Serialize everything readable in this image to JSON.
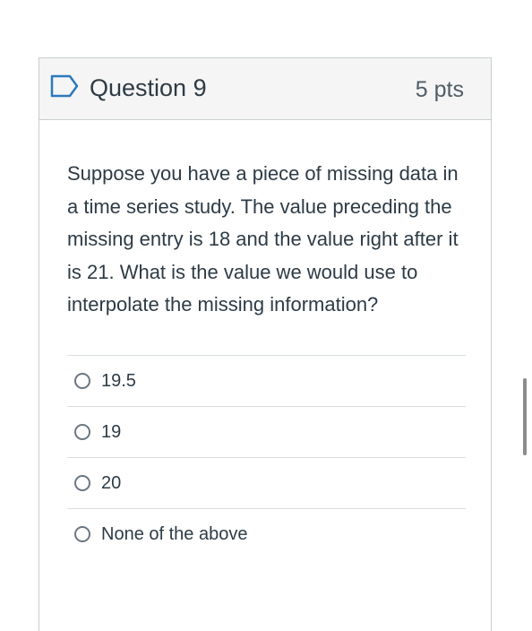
{
  "question": {
    "title": "Question 9",
    "points": "5 pts",
    "flag_icon": "flag-outline-icon",
    "text": "Suppose you have a piece of missing data in a time series study. The value preceding the missing entry is 18 and the value right after it is 21. What is the value we would use to interpolate the missing information?",
    "answers": [
      {
        "label": "19.5",
        "selected": false
      },
      {
        "label": "19",
        "selected": false
      },
      {
        "label": "20",
        "selected": false
      },
      {
        "label": "None of the above",
        "selected": false
      }
    ]
  },
  "colors": {
    "header_bg": "#f5f5f5",
    "border": "#c7cdd1",
    "flag_accent": "#2b7abc",
    "text": "#2d3b45"
  }
}
